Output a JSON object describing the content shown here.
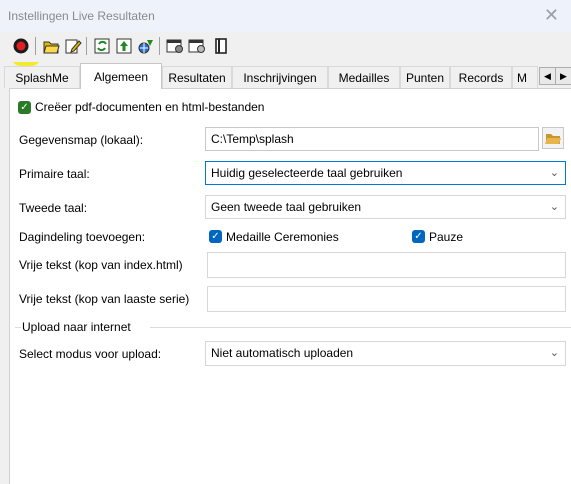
{
  "window": {
    "title": "Instellingen Live Resultaten",
    "close_glyph": "✕"
  },
  "toolbar": {
    "icons": [
      "record-icon",
      "open-icon",
      "edit-icon",
      "refresh-icon",
      "upload-icon",
      "web-icon",
      "settings-icon",
      "settings-alt-icon",
      "book-icon"
    ]
  },
  "tabs": [
    "SplashMe",
    "Algemeen",
    "Resultaten",
    "Inschrijvingen",
    "Medailles",
    "Punten",
    "Records",
    "M"
  ],
  "tab_active": "Algemeen",
  "tab_scroll": {
    "left": "◀",
    "right": "▶"
  },
  "form": {
    "create_docs_label": "Creëer pdf-documenten en html-bestanden",
    "datafolder_label": "Gegevensmap (lokaal):",
    "datafolder_value": "C:\\Temp\\splash",
    "primary_lang_label": "Primaire taal:",
    "primary_lang_value": "Huidig geselecteerde taal gebruiken",
    "second_lang_label": "Tweede taal:",
    "second_lang_value": "Geen tweede taal gebruiken",
    "day_schedule_label": "Dagindeling toevoegen:",
    "medal_ceremonies_label": "Medaille Ceremonies",
    "pause_label": "Pauze",
    "free_text_index_label": "Vrije tekst (kop van index.html)",
    "free_text_index_value": "",
    "free_text_last_label": "Vrije tekst (kop van laaste serie)",
    "free_text_last_value": "",
    "upload_group_label": "Upload naar internet",
    "upload_mode_label": "Select modus voor upload:",
    "upload_mode_value": "Niet automatisch uploaden"
  },
  "colors": {
    "highlight": "#f2ea1c",
    "accent": "#0067c0",
    "checkbox_green": "#2a7a27"
  }
}
